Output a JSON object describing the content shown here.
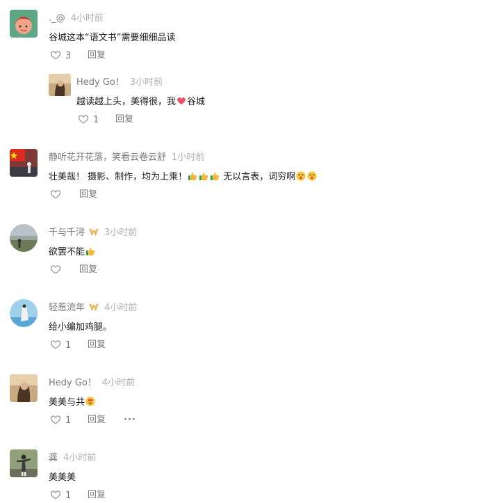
{
  "reply_label": "回复",
  "more_label": "···",
  "comments": [
    {
      "name": "._@",
      "time": "4小时前",
      "text": "谷城这本“语文书”需要细细品读",
      "likes": "3",
      "reply": {
        "name": "Hedy Go！",
        "time": "3小时前",
        "text": "越读越上头，美得很，我",
        "text_tail": "谷城",
        "likes": "1"
      }
    },
    {
      "name": "静听花开花落，笑看云卷云舒",
      "time": "1小时前",
      "text": "壮美哉！ 摄影、制作，均为上乘！",
      "text_tail": " 无以言表，词穷啊",
      "likes": ""
    },
    {
      "name": "千与千浔",
      "time": "3小时前",
      "text": "欲罢不能",
      "likes": ""
    },
    {
      "name": "轻惹流年",
      "time": "4小时前",
      "text": "给小编加鸡腿。",
      "likes": "1"
    },
    {
      "name": "Hedy Go！",
      "time": "4小时前",
      "text": "美美与共",
      "likes": "1"
    },
    {
      "name": "龚",
      "time": "4小时前",
      "text": "美美美",
      "likes": "1"
    }
  ]
}
